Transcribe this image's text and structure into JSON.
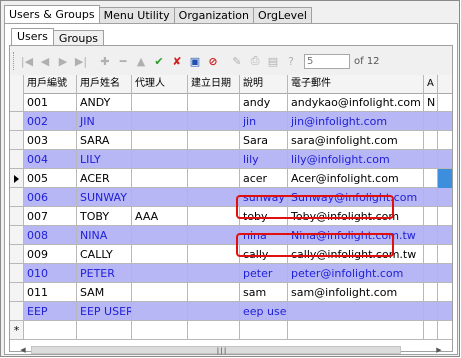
{
  "top_tabs": [
    "Users & Groups",
    "Menu Utility",
    "Organization",
    "OrgLevel"
  ],
  "sub_tabs": [
    "Users",
    "Groups"
  ],
  "navigator": {
    "position": "5",
    "of_label": "of 12"
  },
  "columns": [
    "用戶編號",
    "用戶姓名",
    "代理人",
    "建立日期",
    "說明",
    "電子郵件",
    "A"
  ],
  "rows": [
    {
      "id": "001",
      "name": "ANDY",
      "agent": "",
      "created": "",
      "desc": "andy",
      "email": "andykao@infolight.com",
      "extra": "N"
    },
    {
      "id": "002",
      "name": "JIN",
      "agent": "",
      "created": "",
      "desc": "jin",
      "email": "jin@infolight.com",
      "extra": ""
    },
    {
      "id": "003",
      "name": "SARA",
      "agent": "",
      "created": "",
      "desc": "Sara",
      "email": "sara@infolight.com",
      "extra": ""
    },
    {
      "id": "004",
      "name": "LILY",
      "agent": "",
      "created": "",
      "desc": "lily",
      "email": "lily@infolight.com",
      "extra": ""
    },
    {
      "id": "005",
      "name": "ACER",
      "agent": "",
      "created": "",
      "desc": "acer",
      "email": "Acer@infolight.com",
      "extra": ""
    },
    {
      "id": "006",
      "name": "SUNWAY",
      "agent": "",
      "created": "",
      "desc": "sunway",
      "email": "Sunway@infolight.com",
      "extra": ""
    },
    {
      "id": "007",
      "name": "TOBY",
      "agent": "AAA",
      "created": "",
      "desc": "toby",
      "email": "Toby@infolight.com",
      "extra": ""
    },
    {
      "id": "008",
      "name": "NINA",
      "agent": "",
      "created": "",
      "desc": "nina",
      "email": "Nina@infolight.com.tw",
      "extra": ""
    },
    {
      "id": "009",
      "name": "CALLY",
      "agent": "",
      "created": "",
      "desc": "cally",
      "email": "cally@infolight.com.tw",
      "extra": ""
    },
    {
      "id": "010",
      "name": "PETER",
      "agent": "",
      "created": "",
      "desc": "peter",
      "email": "peter@infolight.com",
      "extra": ""
    },
    {
      "id": "011",
      "name": "SAM",
      "agent": "",
      "created": "",
      "desc": "sam",
      "email": "sam@infolight.com",
      "extra": ""
    },
    {
      "id": "EEP",
      "name": "EEP USER",
      "agent": "",
      "created": "",
      "desc": "eep user",
      "email": "",
      "extra": ""
    }
  ],
  "new_row_marker": "*",
  "current_row_index": 4,
  "colors": {
    "alt_row": "#b7b7f5",
    "alt_text": "#2020d8",
    "highlight": "#e01010",
    "selection": "#3d8edd"
  }
}
